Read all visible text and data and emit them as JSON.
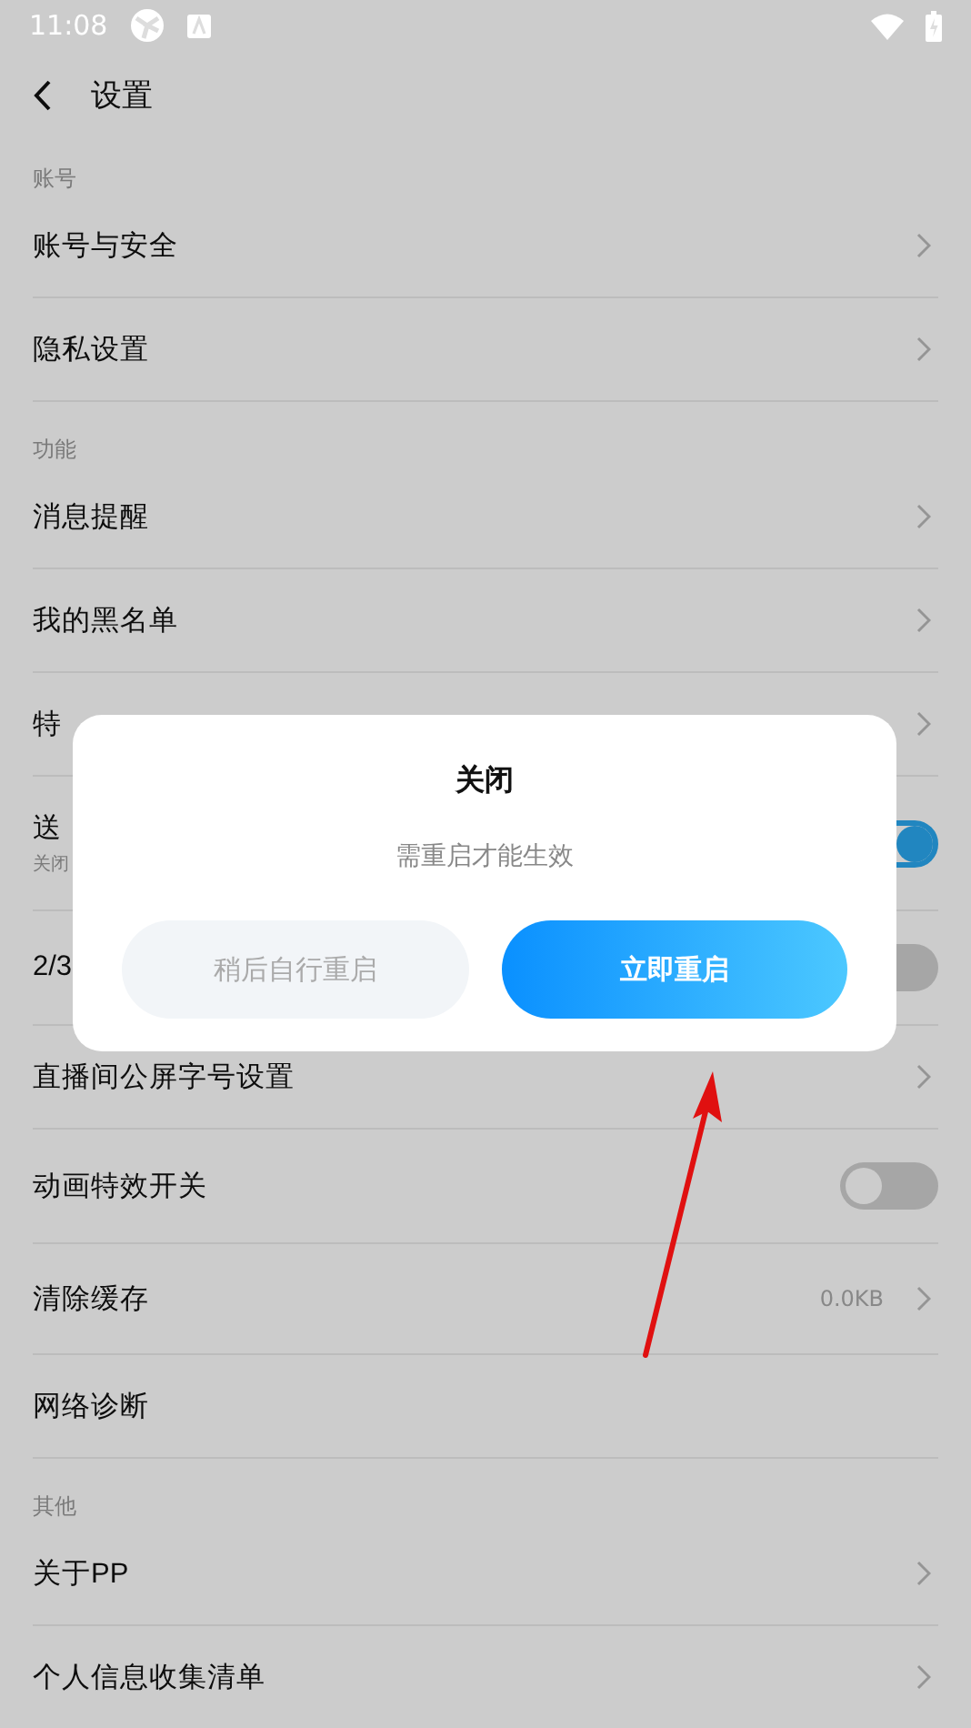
{
  "status_bar": {
    "time": "11:08"
  },
  "header": {
    "title": "设置"
  },
  "sections": [
    {
      "header": "账号",
      "items": [
        {
          "kind": "chevron",
          "label": "账号与安全"
        },
        {
          "kind": "chevron",
          "label": "隐私设置"
        }
      ]
    },
    {
      "header": "功能",
      "items": [
        {
          "kind": "chevron",
          "label": "消息提醒"
        },
        {
          "kind": "chevron",
          "label": "我的黑名单"
        },
        {
          "kind": "chevron",
          "label": "特"
        },
        {
          "kind": "toggle",
          "label": "送",
          "subtitle": "关闭",
          "on": true
        },
        {
          "kind": "toggle",
          "label": "2/3",
          "on": false
        },
        {
          "kind": "chevron",
          "label": "直播间公屏字号设置"
        },
        {
          "kind": "toggle",
          "label": "动画特效开关",
          "on": false
        },
        {
          "kind": "value",
          "label": "清除缓存",
          "value": "0.0KB"
        },
        {
          "kind": "plain",
          "label": "网络诊断"
        }
      ]
    },
    {
      "header": "其他",
      "items": [
        {
          "kind": "chevron",
          "label": "关于PP"
        },
        {
          "kind": "chevron",
          "label": "个人信息收集清单"
        }
      ]
    }
  ],
  "dialog": {
    "title": "关闭",
    "message": "需重启才能生效",
    "buttons": [
      {
        "label": "稍后自行重启",
        "primary": false
      },
      {
        "label": "立即重启",
        "primary": true
      }
    ]
  },
  "annotation": {
    "kind": "arrow"
  }
}
